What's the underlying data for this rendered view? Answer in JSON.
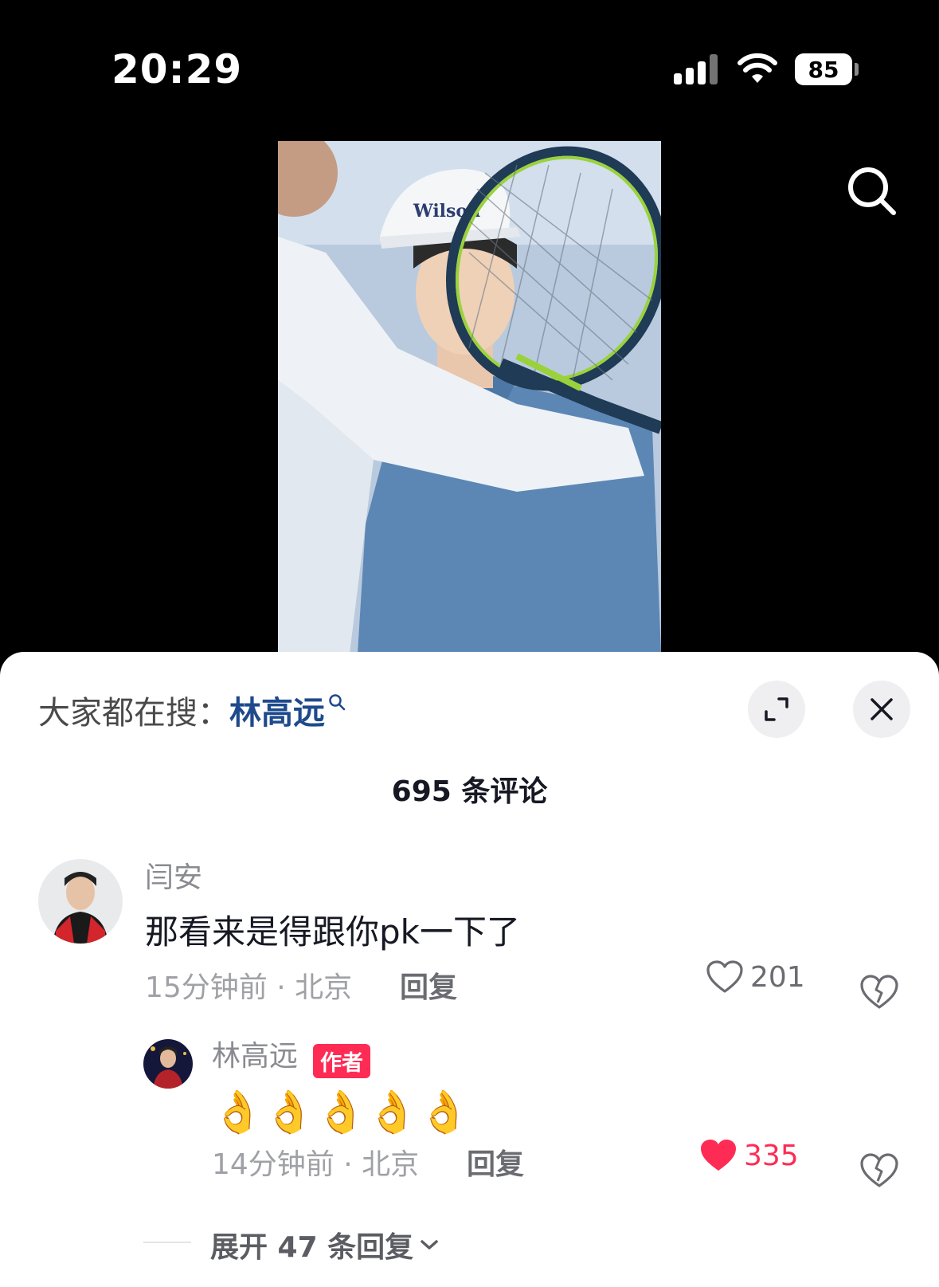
{
  "status": {
    "time": "20:29",
    "battery": "85"
  },
  "trending": {
    "label": "大家都在搜：",
    "term": "林高远"
  },
  "comments": {
    "count_label": "695 条评论",
    "items": [
      {
        "user": "闫安",
        "text": "那看来是得跟你pk一下了",
        "meta": "15分钟前 · 北京",
        "reply": "回复",
        "likes": "201"
      }
    ],
    "reply": {
      "user": "林高远",
      "badge": "作者",
      "text": "👌👌👌👌👌",
      "meta": "14分钟前 · 北京",
      "reply": "回复",
      "likes": "335"
    },
    "expand_label": "展开 47 条回复"
  },
  "colors": {
    "accent": "#fe2c55",
    "trend_term": "#1e4a8c"
  },
  "icons": [
    "search-icon",
    "expand-icon",
    "close-icon",
    "heart-icon",
    "heart-filled-icon",
    "broken-heart-icon",
    "chevron-down-icon"
  ]
}
